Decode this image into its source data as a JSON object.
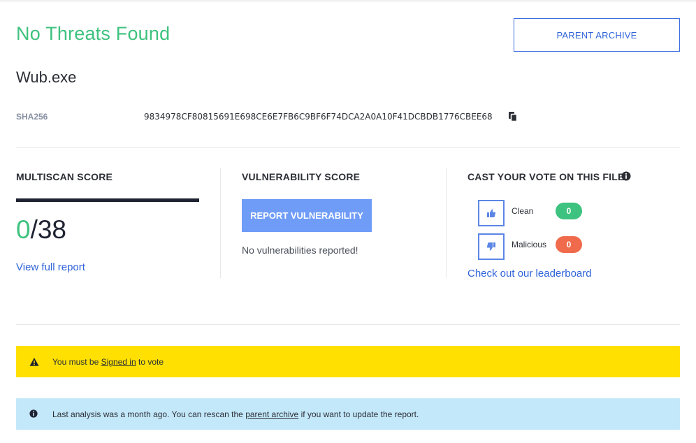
{
  "status": {
    "title": "No Threats Found",
    "color": "#3ec27f"
  },
  "header": {
    "parent_archive_label": "PARENT ARCHIVE"
  },
  "file": {
    "name": "Wub.exe",
    "sha_label": "SHA256",
    "sha_value": "9834978CF80815691E698CE6E7FB6C9BF6F74DCA2A0A10F41DCBDB1776CBEE68"
  },
  "multiscan": {
    "title": "MULTISCAN SCORE",
    "detected": "0",
    "total": "/38",
    "view_report_label": "View full report"
  },
  "vulnerability": {
    "title": "VULNERABILITY SCORE",
    "report_button_label": "REPORT VULNERABILITY",
    "status_text": "No vulnerabilities reported!"
  },
  "vote": {
    "title": "CAST YOUR VOTE ON THIS FILE",
    "clean_label": "Clean",
    "clean_count": "0",
    "clean_color": "#3ec27f",
    "malicious_label": "Malicious",
    "malicious_count": "0",
    "malicious_color": "#f06a4c",
    "leaderboard_label": "Check out our leaderboard"
  },
  "alerts": {
    "signin": {
      "icon": "warning-icon",
      "prefix": "You must be ",
      "link": "Signed in",
      "suffix": " to vote"
    },
    "analysis": {
      "icon": "info-icon",
      "prefix": "Last analysis was a month ago. You can rescan the ",
      "link": "parent archive",
      "suffix": " if you want to update the report."
    }
  }
}
